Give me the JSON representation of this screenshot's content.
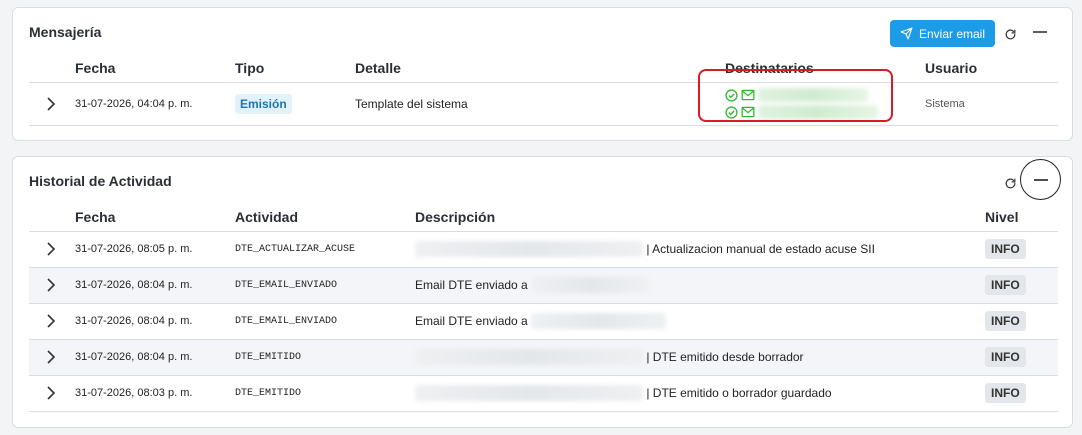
{
  "messaging": {
    "title": "Mensajería",
    "send_button_label": "Enviar email",
    "columns": [
      "Fecha",
      "Tipo",
      "Detalle",
      "Destinatarios",
      "Usuario"
    ],
    "rows": [
      {
        "fecha": "31-07-2026, 04:04 p. m.",
        "tipo": "Emisión",
        "detalle": "Template del sistema",
        "usuario": "Sistema"
      }
    ]
  },
  "history": {
    "title": "Historial de Actividad",
    "columns": [
      "Fecha",
      "Actividad",
      "Descripción",
      "Nivel"
    ],
    "rows": [
      {
        "fecha": "31-07-2026, 08:05 p. m.",
        "actividad": "DTE_ACTUALIZAR_ACUSE",
        "desc_prefix": "",
        "desc_suffix": "| Actualizacion manual de estado acuse SII",
        "nivel": "INFO"
      },
      {
        "fecha": "31-07-2026, 08:04 p. m.",
        "actividad": "DTE_EMAIL_ENVIADO",
        "desc_prefix": "Email DTE enviado a",
        "desc_suffix": "",
        "nivel": "INFO"
      },
      {
        "fecha": "31-07-2026, 08:04 p. m.",
        "actividad": "DTE_EMAIL_ENVIADO",
        "desc_prefix": "Email DTE enviado a",
        "desc_suffix": "",
        "nivel": "INFO"
      },
      {
        "fecha": "31-07-2026, 08:04 p. m.",
        "actividad": "DTE_EMITIDO",
        "desc_prefix": "",
        "desc_suffix": "| DTE emitido desde borrador",
        "nivel": "INFO"
      },
      {
        "fecha": "31-07-2026, 08:03 p. m.",
        "actividad": "DTE_EMITIDO",
        "desc_prefix": "",
        "desc_suffix": "| DTE emitido o borrador guardado",
        "nivel": "INFO"
      }
    ]
  },
  "icons": {
    "send": "paper-plane-icon",
    "refresh": "refresh-icon",
    "minimize": "minus-icon",
    "expand": "chevron-right-icon",
    "delivered": "check-circle-icon",
    "mail": "envelope-icon"
  },
  "colors": {
    "accent": "#1c9be6",
    "success": "#2eb82e",
    "highlight": "#d81b24"
  }
}
